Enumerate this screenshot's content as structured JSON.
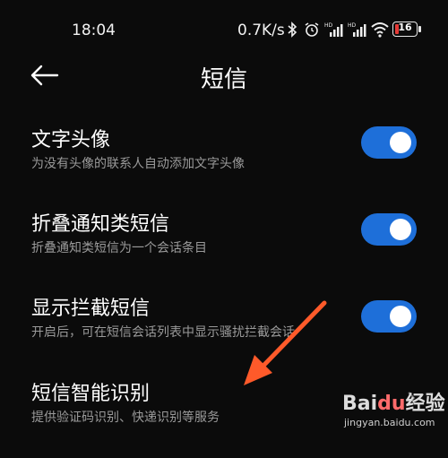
{
  "status_bar": {
    "time": "18:04",
    "network_speed": "0.7K/s",
    "battery_level": "16",
    "icons": [
      "bluetooth-icon",
      "alarm-icon",
      "signal-hd-icon",
      "signal-hd-icon",
      "wifi-icon",
      "battery-icon"
    ]
  },
  "header": {
    "title": "短信",
    "back_icon": "back-arrow-icon"
  },
  "settings": [
    {
      "title": "文字头像",
      "subtitle": "为没有头像的联系人自动添加文字头像",
      "toggle_on": true
    },
    {
      "title": "折叠通知类短信",
      "subtitle": "折叠通知类短信为一个会话条目",
      "toggle_on": true
    },
    {
      "title": "显示拦截短信",
      "subtitle": "开启后，可在短信会话列表中显示骚扰拦截会话",
      "toggle_on": true
    },
    {
      "title": "短信智能识别",
      "subtitle": "提供验证码识别、快递识别等服务",
      "control": "chevron-right-icon"
    }
  ],
  "colors": {
    "accent": "#1e6fd9",
    "annotation_arrow": "#ff5a2a",
    "background": "#0b0b0b"
  },
  "watermark": {
    "logo_left": "Bai",
    "logo_mid": "du",
    "logo_right": "经验",
    "url": "jingyan.baidu.com"
  }
}
